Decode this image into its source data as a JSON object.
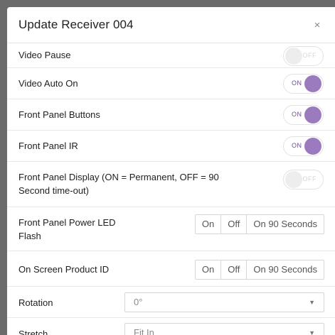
{
  "dialog": {
    "title": "Update Receiver 004",
    "close_glyph": "×"
  },
  "settings": [
    {
      "label": "Video Pause",
      "type": "toggle",
      "state": "OFF"
    },
    {
      "label": "Video Auto On",
      "type": "toggle",
      "state": "ON"
    },
    {
      "label": "Front Panel Buttons",
      "type": "toggle",
      "state": "ON"
    },
    {
      "label": "Front Panel IR",
      "type": "toggle",
      "state": "ON"
    },
    {
      "label_line1": "Front Panel Display (ON = Permanent, OFF = 90",
      "label_line2": "Second time-out)",
      "type": "toggle",
      "state": "OFF"
    },
    {
      "label_line1": "Front Panel Power LED",
      "label_line2": "Flash",
      "type": "segmented",
      "options": [
        "On",
        "Off",
        "On 90 Seconds"
      ]
    },
    {
      "label": "On Screen Product ID",
      "type": "segmented",
      "options": [
        "On",
        "Off",
        "On 90 Seconds"
      ]
    },
    {
      "label": "Rotation",
      "type": "select",
      "value": "0°"
    },
    {
      "label": "Stretch",
      "type": "select",
      "value": "Fit In"
    }
  ],
  "colors": {
    "toggle_on_knob": "#9b7bbd",
    "toggle_on_text": "#6b4f8f",
    "toggle_off_knob": "#ededed"
  }
}
